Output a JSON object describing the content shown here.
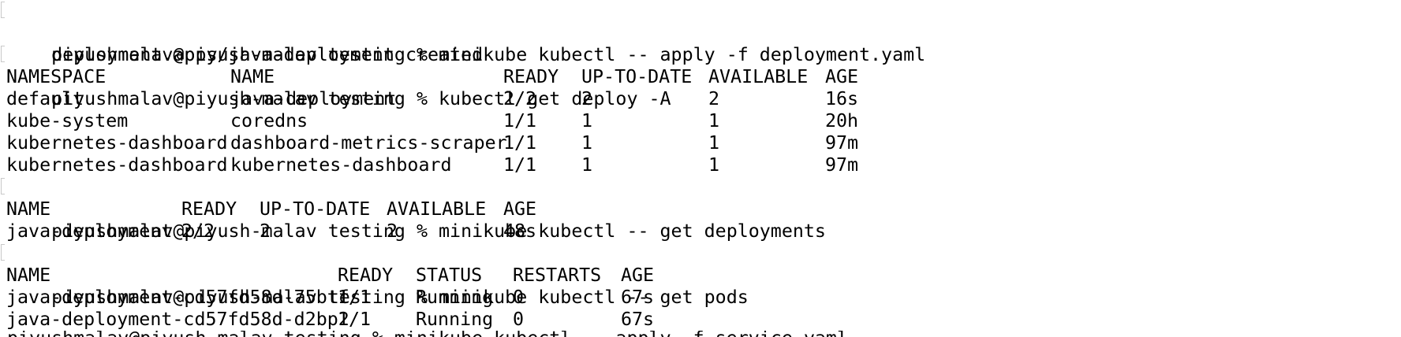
{
  "terminal": {
    "commands": {
      "c1": "piyushmalav@piyush-malav testing % minikube kubectl -- apply -f deployment.yaml",
      "c2": "piyushmalav@piyush-malav testing % kubectl get deploy -A",
      "c3": "piyushmalav@piyush-malav testing % minikube kubectl -- get deployments",
      "c4": "piyushmalav@piyush-malav testing % minikube kubectl -- get pods"
    },
    "apply_output": "deployment.apps/java-deployment created",
    "deploy_all": {
      "headers": [
        "NAMESPACE",
        "NAME",
        "READY",
        "UP-TO-DATE",
        "AVAILABLE",
        "AGE"
      ],
      "rows": [
        [
          "default",
          "java-deployment",
          "2/2",
          "2",
          "2",
          "16s"
        ],
        [
          "kube-system",
          "coredns",
          "1/1",
          "1",
          "1",
          "20h"
        ],
        [
          "kubernetes-dashboard",
          "dashboard-metrics-scraper",
          "1/1",
          "1",
          "1",
          "97m"
        ],
        [
          "kubernetes-dashboard",
          "kubernetes-dashboard",
          "1/1",
          "1",
          "1",
          "97m"
        ]
      ]
    },
    "deployments": {
      "headers": [
        "NAME",
        "READY",
        "UP-TO-DATE",
        "AVAILABLE",
        "AGE"
      ],
      "rows": [
        [
          "java-deployment",
          "2/2",
          "2",
          "2",
          "48s"
        ]
      ]
    },
    "pods": {
      "headers": [
        "NAME",
        "READY",
        "STATUS",
        "RESTARTS",
        "AGE"
      ],
      "rows": [
        [
          "java-deployment-cd57fd58d-75btf",
          "1/1",
          "Running",
          "0",
          "67s"
        ],
        [
          "java-deployment-cd57fd58d-d2bp2",
          "1/1",
          "Running",
          "0",
          "67s"
        ]
      ]
    },
    "partial_next_line": "piyushmalav@piyush-malav testing % minikube kubectl -- apply -f service.yaml"
  }
}
